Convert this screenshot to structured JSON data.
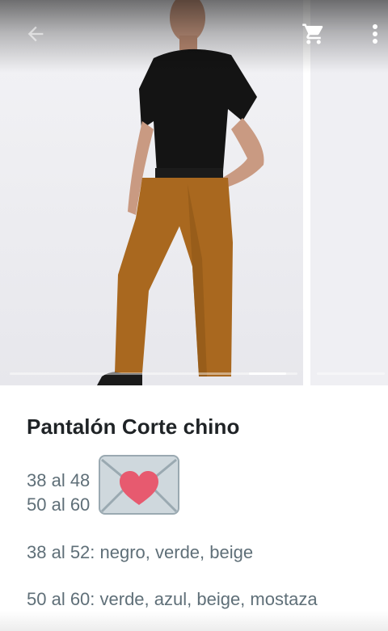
{
  "toolbar": {
    "back_icon": "arrow-left-icon",
    "cart_icon": "shopping-cart-icon",
    "menu_icon": "more-vert-icon"
  },
  "gallery": {
    "image_subject": "model-wearing-brown-chino-pants",
    "current_index": 1,
    "image_count": 2
  },
  "product": {
    "title": "Pantalón Corte chino",
    "size_line_1": "38 al 48",
    "size_line_2": "50 al 60",
    "emoji": "love-letter-icon",
    "colors_line_1": "38 al 52: negro, verde, beige",
    "colors_line_2": "50 al 60: verde, azul, beige, mostaza"
  },
  "colors": {
    "title_text": "#1f2326",
    "body_text": "#5f6f78",
    "pants": "#a9681f",
    "shirt": "#141414",
    "heart": "#e75a6f",
    "envelope": "#cfd8dd"
  }
}
